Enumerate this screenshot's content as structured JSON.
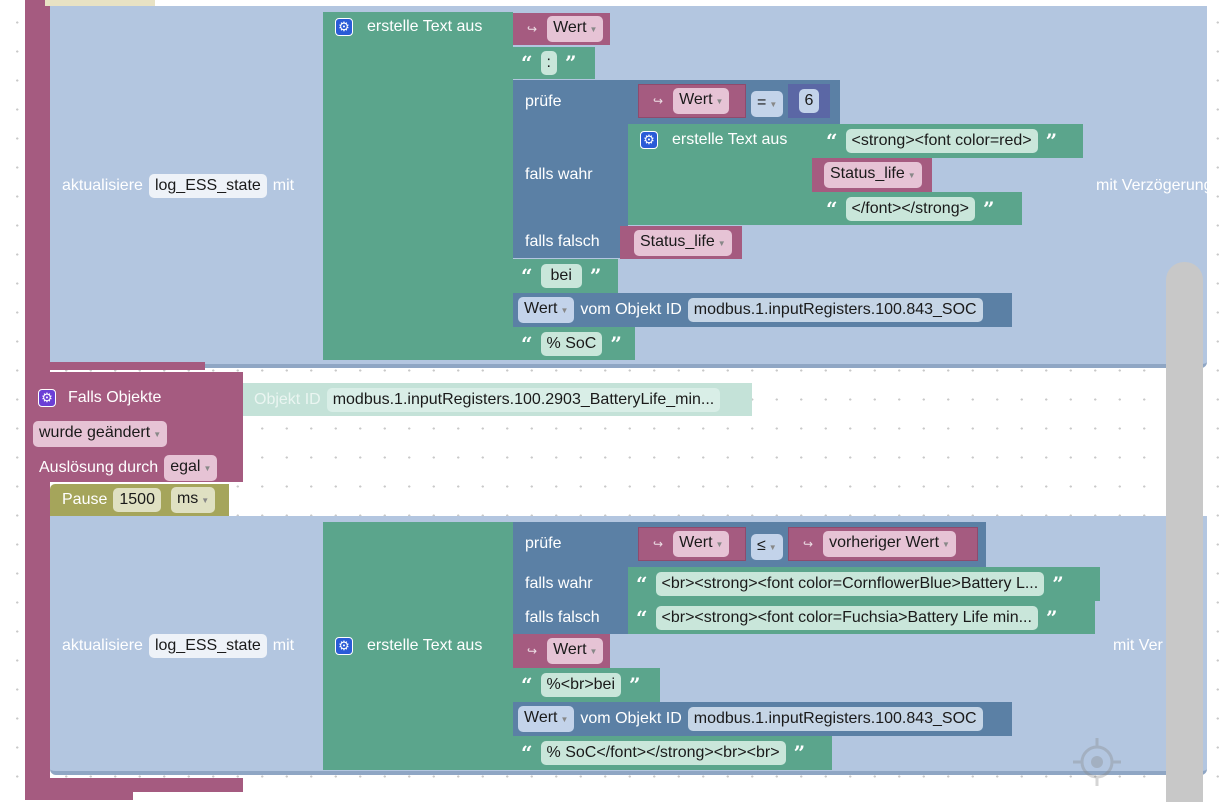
{
  "block1": {
    "update_label": "aktualisiere",
    "variable": "log_ESS_state",
    "with_label": "mit",
    "delay_label": "mit Verzögerung",
    "join_label": "erstelle Text aus",
    "var_wert": "Wert",
    "text_colon": ":",
    "if_label": "prüfe",
    "then_label": "falls wahr",
    "else_label": "falls falsch",
    "cmp_left": "Wert",
    "cmp_op": "=",
    "cmp_right": "6",
    "inner_join_label": "erstelle Text aus",
    "inner_text1": "<strong><font color=red>",
    "inner_var": "Status_life",
    "inner_text2": "</font></strong>",
    "else_var": "Status_life",
    "text_bei": "bei",
    "get_value": "Wert",
    "get_label": "vom Objekt ID",
    "object_id": "modbus.1.inputRegisters.100.843_SOC",
    "text_soc": "% SoC"
  },
  "trigger": {
    "title": "Falls Objekte",
    "object_label": "Objekt ID",
    "object_id": "modbus.1.inputRegisters.100.2903_BatteryLife_min...",
    "condition": "wurde geändert",
    "trigger_label": "Auslösung durch",
    "trigger_value": "egal"
  },
  "pause": {
    "label": "Pause",
    "value": "1500",
    "unit": "ms"
  },
  "block2": {
    "update_label": "aktualisiere",
    "variable": "log_ESS_state",
    "with_label": "mit",
    "delay_label": "mit Ver",
    "join_label": "erstelle Text aus",
    "if_label": "prüfe",
    "then_label": "falls wahr",
    "else_label": "falls falsch",
    "cmp_left": "Wert",
    "cmp_op": "≤",
    "cmp_right": "vorheriger Wert",
    "then_text": "<br><strong><font color=CornflowerBlue>Battery L...",
    "else_text": "<br><strong><font color=Fuchsia>Battery Life min...",
    "var_wert": "Wert",
    "text_bei": "%<br>bei",
    "get_value": "Wert",
    "get_label": "vom Objekt ID",
    "object_id": "modbus.1.inputRegisters.100.843_SOC",
    "text_soc": "% SoC</font></strong><br><br>"
  },
  "colors": {
    "event": "#a55b80",
    "text": "#5ba58c",
    "logic": "#5b80a5",
    "update": "#b3c6e0",
    "pause": "#a5a55b",
    "number": "#5b67a5"
  }
}
